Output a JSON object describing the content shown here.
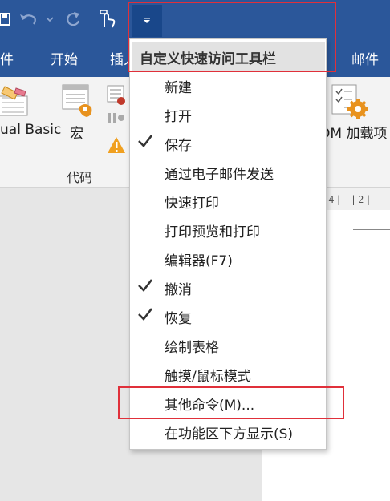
{
  "tabs": {
    "file": "件",
    "start": "开始",
    "insert": "插入",
    "mail": "邮件"
  },
  "ribbon": {
    "vb_label": "ual Basic",
    "macro_label": "宏",
    "addin_label": "OM 加载项",
    "group_label": "代码"
  },
  "ruler": {
    "text": "|4|  |2|"
  },
  "menu": {
    "header": "自定义快速访问工具栏",
    "items": [
      {
        "label": "新建",
        "checked": false
      },
      {
        "label": "打开",
        "checked": false
      },
      {
        "label": "保存",
        "checked": true
      },
      {
        "label": "通过电子邮件发送",
        "checked": false
      },
      {
        "label": "快速打印",
        "checked": false
      },
      {
        "label": "打印预览和打印",
        "checked": false
      },
      {
        "label": "编辑器(F7)",
        "checked": false
      },
      {
        "label": "撤消",
        "checked": true
      },
      {
        "label": "恢复",
        "checked": true
      },
      {
        "label": "绘制表格",
        "checked": false
      },
      {
        "label": "触摸/鼠标模式",
        "checked": false
      },
      {
        "label": "其他命令(M)...",
        "checked": false
      },
      {
        "label": "在功能区下方显示(S)",
        "checked": false
      }
    ]
  },
  "colors": {
    "accent": "#2b579a",
    "highlight": "#e0303a",
    "orange": "#e8921e"
  }
}
